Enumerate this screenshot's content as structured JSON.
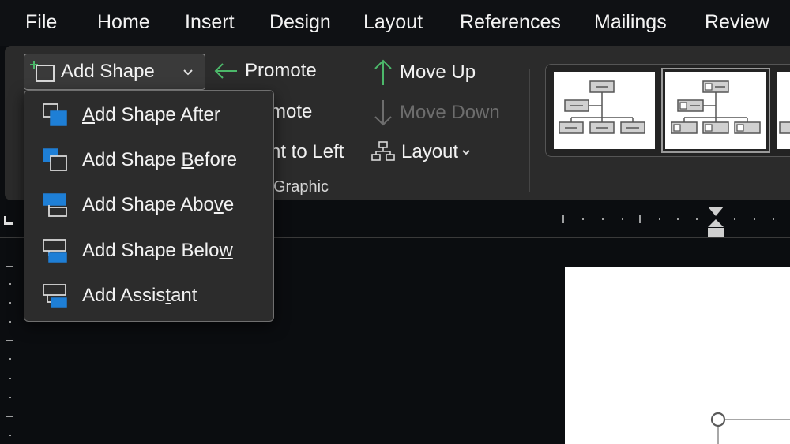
{
  "menubar": {
    "tabs": [
      "File",
      "Home",
      "Insert",
      "Design",
      "Layout",
      "References",
      "Mailings",
      "Review"
    ]
  },
  "ribbon": {
    "add_shape_label": "Add Shape",
    "promote_label": "Promote",
    "demote_partial": "mote",
    "rtl_partial": "ht to Left",
    "group_partial": "Graphic",
    "move_up_label": "Move Up",
    "move_down_label": "Move Down",
    "layout_label": "Layout"
  },
  "dropdown": {
    "items": [
      {
        "pre": "",
        "u": "A",
        "post": "dd Shape After",
        "icon": "add-shape-after-icon"
      },
      {
        "pre": "Add Shape ",
        "u": "B",
        "post": "efore",
        "icon": "add-shape-before-icon"
      },
      {
        "pre": "Add Shape Abo",
        "u": "v",
        "post": "e",
        "icon": "add-shape-above-icon"
      },
      {
        "pre": "Add Shape Belo",
        "u": "w",
        "post": "",
        "icon": "add-shape-below-icon"
      },
      {
        "pre": "Add Assis",
        "u": "t",
        "post": "ant",
        "icon": "add-assistant-icon"
      }
    ]
  },
  "colors": {
    "accent_blue": "#1e7fd6",
    "green_arrow": "#4cb86a",
    "ribbon_bg": "#2b2b2b",
    "menu_bg": "#0f1114"
  }
}
